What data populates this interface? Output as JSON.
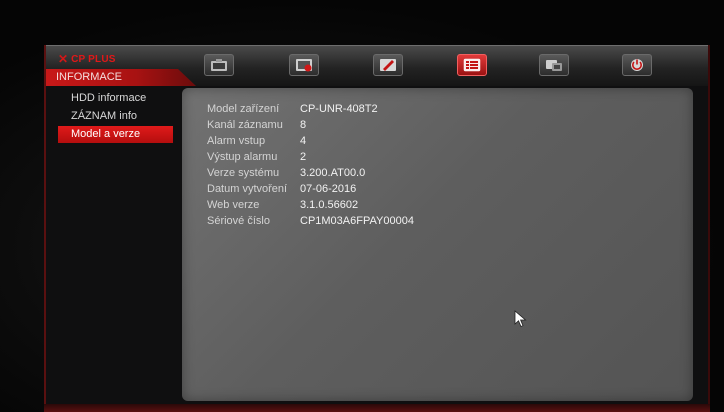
{
  "brand": {
    "logo_text": "CP PLUS",
    "logo_sub": "",
    "section_title": "INFORMACE"
  },
  "toolbar": {
    "tabs": [
      {
        "icon": "camera-icon"
      },
      {
        "icon": "record-icon"
      },
      {
        "icon": "alarm-icon"
      },
      {
        "icon": "info-icon",
        "active": true
      },
      {
        "icon": "network-icon"
      },
      {
        "icon": "shutdown-icon"
      }
    ]
  },
  "sidebar": {
    "items": [
      {
        "label": "HDD informace"
      },
      {
        "label": "ZÁZNAM info"
      },
      {
        "label": "Model a verze",
        "active": true
      }
    ]
  },
  "info": {
    "rows": [
      {
        "label": "Model zařízení",
        "value": "CP-UNR-408T2"
      },
      {
        "label": "Kanál záznamu",
        "value": "8"
      },
      {
        "label": "Alarm vstup",
        "value": "4"
      },
      {
        "label": "Výstup alarmu",
        "value": "2"
      },
      {
        "label": "Verze systému",
        "value": "3.200.AT00.0"
      },
      {
        "label": "Datum vytvoření",
        "value": "07-06-2016"
      },
      {
        "label": "Web verze",
        "value": "3.1.0.56602"
      },
      {
        "label": "Sériové číslo",
        "value": "CP1M03A6FPAY00004"
      }
    ]
  },
  "colors": {
    "accent": "#d01818",
    "panel": "#666666",
    "background": "#0f0f10"
  }
}
